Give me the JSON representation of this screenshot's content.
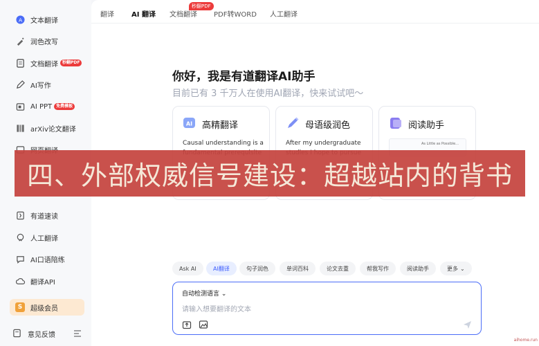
{
  "sidebar": {
    "items": [
      {
        "label": "文本翻译",
        "icon": "translate-icon"
      },
      {
        "label": "润色改写",
        "icon": "polish-icon"
      },
      {
        "label": "文档翻译",
        "icon": "document-icon",
        "badge": "秒翻PDF"
      },
      {
        "label": "AI写作",
        "icon": "pen-icon"
      },
      {
        "label": "AI PPT",
        "icon": "ppt-icon",
        "badge": "免费模板"
      },
      {
        "label": "arXiv论文翻译",
        "icon": "paper-icon"
      },
      {
        "label": "有道速读",
        "icon": "speed-read-icon"
      },
      {
        "label": "人工翻译",
        "icon": "human-icon"
      },
      {
        "label": "AI口语陪练",
        "icon": "speaking-icon"
      },
      {
        "label": "翻译API",
        "icon": "cloud-icon"
      },
      {
        "label": "超级会员",
        "icon": "vip-icon"
      }
    ],
    "partial_item": "网页翻译",
    "feedback": "意见反馈"
  },
  "tabs": [
    {
      "label": "翻译"
    },
    {
      "label": "AI 翻译"
    },
    {
      "label": "文档翻译"
    },
    {
      "label": "PDF转WORD"
    },
    {
      "label": "人工翻译"
    }
  ],
  "tab_badge": "秒翻PDF",
  "greeting": {
    "title": "你好，我是有道翻译AI助手",
    "subtitle": "目前已有 3 千万人在使用AI翻译，快来试试吧～"
  },
  "cards": [
    {
      "title": "高精翻译",
      "desc": "Causal understanding is a fundamental prerequisite",
      "icon": "ai-chip-icon"
    },
    {
      "title": "母语级润色",
      "desc": "After my undergraduate studies I hope to pursue",
      "icon": "pen-polish-icon"
    },
    {
      "title": "阅读助手",
      "doc_text": "As Little as Possible...",
      "icon": "book-icon"
    }
  ],
  "chips": [
    "Ask AI",
    "AI翻译",
    "句子润色",
    "单词百科",
    "论文去重",
    "帮我写作",
    "阅读助手",
    "更多"
  ],
  "input": {
    "lang": "自动检测语言",
    "placeholder": "请输入想要翻译的文本"
  },
  "banner": "四、外部权威信号建设：超越站内的背书",
  "watermark": "aihome.run",
  "colors": {
    "accent": "#4a6cf7",
    "banner": "#c5443f",
    "badge": "#ec3b3b"
  }
}
